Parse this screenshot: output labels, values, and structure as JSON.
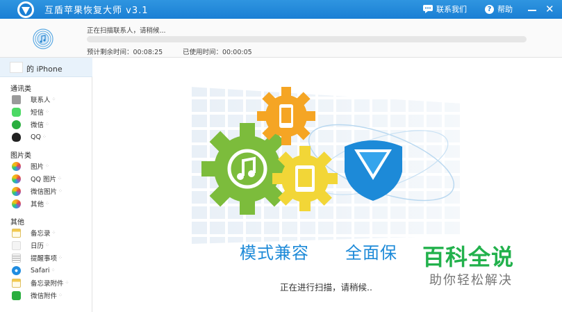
{
  "app": {
    "title": "互盾苹果恢复大师 v3.1",
    "contact_label": "联系我们",
    "help_label": "帮助",
    "help_glyph": "?",
    "close_glyph": "✕"
  },
  "progress": {
    "status": "正在扫描联系人，请稍候...",
    "remaining": "预计剩余时间：00:08:25",
    "elapsed": "已使用时间：00:00:05",
    "percent": 0
  },
  "device": {
    "name": "的 iPhone"
  },
  "sidebar": {
    "categories": [
      {
        "label": "通讯类",
        "items": [
          {
            "label": "联系人",
            "icon": "contacts-icon"
          },
          {
            "label": "短信",
            "icon": "messages-icon"
          },
          {
            "label": "微信",
            "icon": "wechat-icon"
          },
          {
            "label": "QQ",
            "icon": "qq-icon"
          }
        ]
      },
      {
        "label": "图片类",
        "items": [
          {
            "label": "图片",
            "icon": "photos-icon"
          },
          {
            "label": "QQ 图片",
            "icon": "qq-photos-icon"
          },
          {
            "label": "微信图片",
            "icon": "wechat-photos-icon"
          },
          {
            "label": "其他",
            "icon": "other-photos-icon"
          }
        ]
      },
      {
        "label": "其他",
        "items": [
          {
            "label": "备忘录",
            "icon": "notes-icon"
          },
          {
            "label": "日历",
            "icon": "calendar-icon"
          },
          {
            "label": "提醒事项",
            "icon": "reminders-icon"
          },
          {
            "label": "Safari",
            "icon": "safari-icon"
          },
          {
            "label": "备忘录附件",
            "icon": "notes-attachment-icon"
          },
          {
            "label": "微信附件",
            "icon": "wechat-attachment-icon"
          }
        ]
      }
    ],
    "loading_glyph": "⁘"
  },
  "main": {
    "slogan_left": "模式兼容",
    "slogan_right": "全面保",
    "scanning_text": "正在进行扫描，请稍候.."
  },
  "watermark": {
    "title": "百科全说",
    "subtitle": "助你轻松解决"
  },
  "colors": {
    "titlebar": "#1a7fd4",
    "accent_blue": "#1d8ad8",
    "gear_green": "#7cbc3c",
    "gear_orange": "#f5a524",
    "gear_yellow": "#f2d637",
    "watermark_green": "#22b14c"
  }
}
